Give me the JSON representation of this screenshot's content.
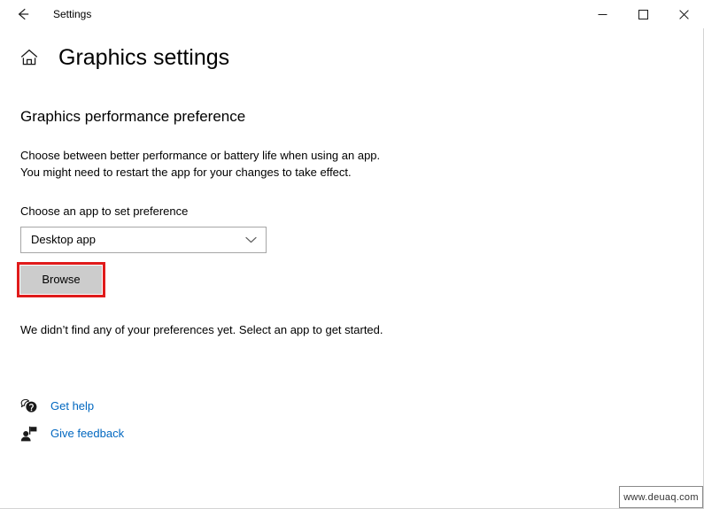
{
  "window": {
    "titlebar": {
      "back_label": "back-arrow",
      "title": "Settings",
      "minimize_label": "Minimize",
      "maximize_label": "Maximize",
      "close_label": "Close"
    },
    "border_color": "#d4d4d4"
  },
  "header": {
    "home_icon": "home-icon",
    "title": "Graphics settings"
  },
  "main": {
    "section_heading": "Graphics performance preference",
    "description_line1": "Choose between better performance or battery life when using an app.",
    "description_line2": "You might need to restart the app for your changes to take effect.",
    "field_label": "Choose an app to set preference",
    "dropdown": {
      "value": "Desktop app",
      "chevron_icon": "chevron-down-icon",
      "options": [
        "Desktop app"
      ]
    },
    "browse_button": {
      "label": "Browse",
      "highlight_color": "#e01b1b",
      "fill_color": "#cccccc"
    },
    "empty_state": "We didn’t find any of your preferences yet. Select an app to get started."
  },
  "footer": {
    "link_color": "#0067c0",
    "links": [
      {
        "icon": "help-bubble-icon",
        "label": "Get help"
      },
      {
        "icon": "feedback-person-icon",
        "label": "Give feedback"
      }
    ]
  },
  "watermark": {
    "text": "www.deuaq.com"
  }
}
